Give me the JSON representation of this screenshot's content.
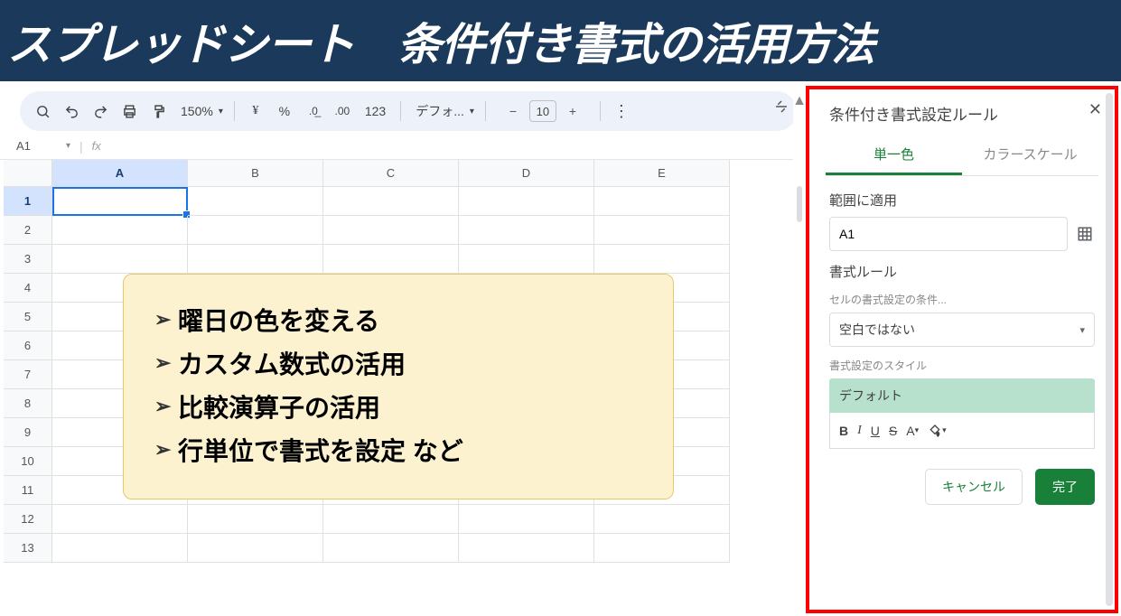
{
  "banner": {
    "title": "スプレッドシート　条件付き書式の活用方法"
  },
  "toolbar": {
    "zoom": "150%",
    "font": "デフォ...",
    "font_size": "10"
  },
  "namebox": {
    "ref": "A1"
  },
  "columns": [
    "A",
    "B",
    "C",
    "D",
    "E"
  ],
  "rows": [
    "1",
    "2",
    "3",
    "4",
    "5",
    "6",
    "7",
    "8",
    "9",
    "10",
    "11",
    "12",
    "13"
  ],
  "bullets": [
    "曜日の色を変える",
    "カスタム数式の活用",
    "比較演算子の活用",
    "行単位で書式を設定 など"
  ],
  "panel": {
    "title": "条件付き書式設定ルール",
    "tab_single": "単一色",
    "tab_scale": "カラースケール",
    "apply_range_label": "範囲に適用",
    "range_value": "A1",
    "rules_label": "書式ルール",
    "condition_label": "セルの書式設定の条件...",
    "condition_value": "空白ではない",
    "style_label": "書式設定のスタイル",
    "style_preview": "デフォルト",
    "cancel": "キャンセル",
    "done": "完了"
  }
}
